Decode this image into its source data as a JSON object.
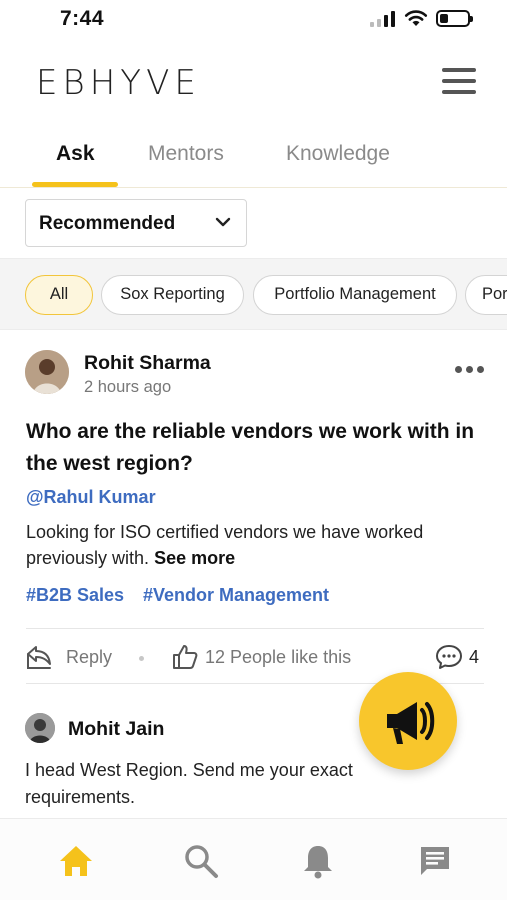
{
  "status_bar": {
    "time": "7:44"
  },
  "header": {
    "logo": "EBHYVE"
  },
  "tabs": [
    {
      "label": "Ask",
      "active": true
    },
    {
      "label": "Mentors",
      "active": false
    },
    {
      "label": "Knowledge",
      "active": false
    }
  ],
  "filter": {
    "selected": "Recommended"
  },
  "chips": [
    {
      "label": "All",
      "active": true
    },
    {
      "label": "Sox Reporting",
      "active": false
    },
    {
      "label": "Portfolio Management",
      "active": false
    },
    {
      "label": "Por",
      "active": false
    }
  ],
  "post": {
    "author": "Rohit Sharma",
    "time": "2 hours ago",
    "question": "Who are the reliable vendors we work with in the west region?",
    "mention": "@Rahul Kumar",
    "body": "Looking for ISO certified vendors we have worked previously with.",
    "see_more": "See more",
    "hashtags": [
      "#B2B Sales",
      "#Vendor Management"
    ],
    "actions": {
      "reply": "Reply",
      "likes": "12 People like this",
      "comments": "4"
    }
  },
  "comment": {
    "author": "Mohit Jain",
    "text": "I head West Region. Send me your exact requirements."
  },
  "bottom_nav": [
    {
      "icon": "home-icon",
      "active": true
    },
    {
      "icon": "search-icon",
      "active": false
    },
    {
      "icon": "bell-icon",
      "active": false
    },
    {
      "icon": "chat-icon",
      "active": false
    }
  ],
  "colors": {
    "accent": "#f5c21b",
    "link": "#3e6cc0",
    "muted": "#777777"
  }
}
